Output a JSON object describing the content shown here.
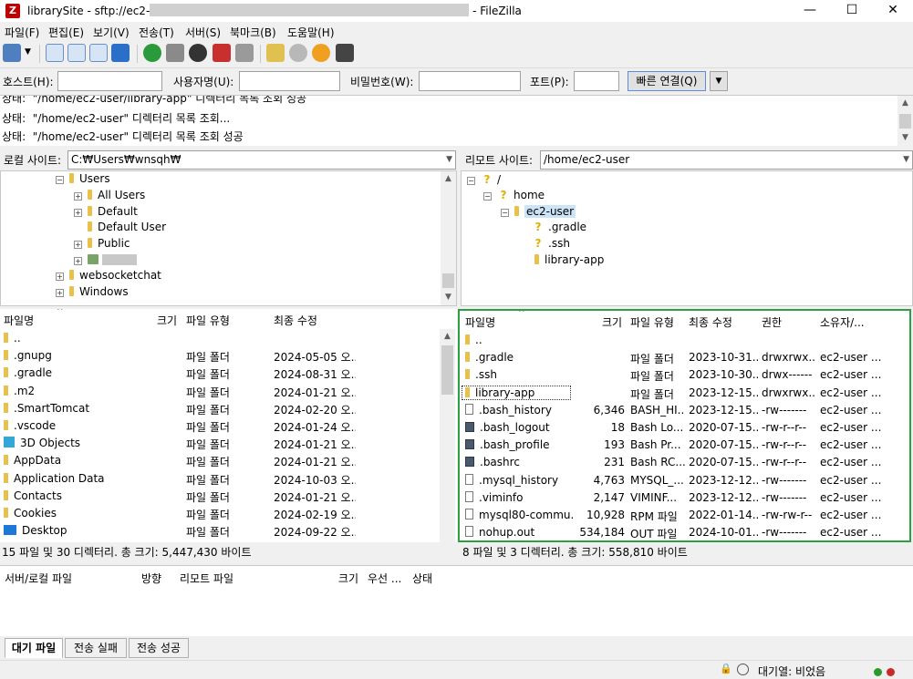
{
  "window": {
    "title_prefix": "librarySite - sftp://ec2-",
    "title_suffix": " - FileZilla"
  },
  "menu": [
    "파일(F)",
    "편집(E)",
    "보기(V)",
    "전송(T)",
    "서버(S)",
    "북마크(B)",
    "도움말(H)"
  ],
  "quickconnect": {
    "host_label": "호스트(H):",
    "user_label": "사용자명(U):",
    "pass_label": "비밀번호(W):",
    "port_label": "포트(P):",
    "connect_label": "빠른 연결(Q)"
  },
  "log": [
    "상태:  \"/home/ec2-user/library-app\" 디렉터리 목록 조회 성공",
    "상태:  \"/home/ec2-user\" 디렉터리 목록 조회...",
    "상태:  \"/home/ec2-user\" 디렉터리 목록 조회 성공"
  ],
  "local": {
    "site_label": "로컬 사이트:",
    "path": "C:₩Users₩wnsqh₩",
    "tree": [
      "Users",
      "All Users",
      "Default",
      "Default User",
      "Public",
      "websocketchat",
      "Windows"
    ],
    "headers": {
      "name": "파일명",
      "size": "크기",
      "type": "파일 유형",
      "modified": "최종 수정"
    },
    "rows": [
      {
        "name": "..",
        "type": "",
        "modified": ""
      },
      {
        "name": ".gnupg",
        "type": "파일 폴더",
        "modified": "2024-05-05 오..."
      },
      {
        "name": ".gradle",
        "type": "파일 폴더",
        "modified": "2024-08-31 오..."
      },
      {
        "name": ".m2",
        "type": "파일 폴더",
        "modified": "2024-01-21 오..."
      },
      {
        "name": ".SmartTomcat",
        "type": "파일 폴더",
        "modified": "2024-02-20 오..."
      },
      {
        "name": ".vscode",
        "type": "파일 폴더",
        "modified": "2024-01-24 오..."
      },
      {
        "name": "3D Objects",
        "type": "파일 폴더",
        "modified": "2024-01-21 오..."
      },
      {
        "name": "AppData",
        "type": "파일 폴더",
        "modified": "2024-01-21 오..."
      },
      {
        "name": "Application Data",
        "type": "파일 폴더",
        "modified": "2024-10-03 오..."
      },
      {
        "name": "Contacts",
        "type": "파일 폴더",
        "modified": "2024-01-21 오..."
      },
      {
        "name": "Cookies",
        "type": "파일 폴더",
        "modified": "2024-02-19 오..."
      },
      {
        "name": "Desktop",
        "type": "파일 폴더",
        "modified": "2024-09-22 오..."
      }
    ],
    "status": "15 파일 및 30 디렉터리. 총 크기: 5,447,430 바이트"
  },
  "remote": {
    "site_label": "리모트 사이트:",
    "path": "/home/ec2-user",
    "tree": [
      "/",
      "home",
      "ec2-user",
      ".gradle",
      ".ssh",
      "library-app"
    ],
    "headers": {
      "name": "파일명",
      "size": "크기",
      "type": "파일 유형",
      "modified": "최종 수정",
      "perm": "권한",
      "owner": "소유자/..."
    },
    "rows": [
      {
        "name": "..",
        "size": "",
        "type": "",
        "modified": "",
        "perm": "",
        "owner": ""
      },
      {
        "name": ".gradle",
        "size": "",
        "type": "파일 폴더",
        "modified": "2023-10-31...",
        "perm": "drwxrwx...",
        "owner": "ec2-user ..."
      },
      {
        "name": ".ssh",
        "size": "",
        "type": "파일 폴더",
        "modified": "2023-10-30...",
        "perm": "drwx------",
        "owner": "ec2-user ..."
      },
      {
        "name": "library-app",
        "size": "",
        "type": "파일 폴더",
        "modified": "2023-12-15...",
        "perm": "drwxrwx...",
        "owner": "ec2-user ..."
      },
      {
        "name": ".bash_history",
        "size": "6,346",
        "type": "BASH_HI...",
        "modified": "2023-12-15...",
        "perm": "-rw-------",
        "owner": "ec2-user ..."
      },
      {
        "name": ".bash_logout",
        "size": "18",
        "type": "Bash Lo...",
        "modified": "2020-07-15...",
        "perm": "-rw-r--r--",
        "owner": "ec2-user ..."
      },
      {
        "name": ".bash_profile",
        "size": "193",
        "type": "Bash Pr...",
        "modified": "2020-07-15...",
        "perm": "-rw-r--r--",
        "owner": "ec2-user ..."
      },
      {
        "name": ".bashrc",
        "size": "231",
        "type": "Bash RC...",
        "modified": "2020-07-15...",
        "perm": "-rw-r--r--",
        "owner": "ec2-user ..."
      },
      {
        "name": ".mysql_history",
        "size": "4,763",
        "type": "MYSQL_...",
        "modified": "2023-12-12...",
        "perm": "-rw-------",
        "owner": "ec2-user ..."
      },
      {
        "name": ".viminfo",
        "size": "2,147",
        "type": "VIMINF...",
        "modified": "2023-12-12...",
        "perm": "-rw-------",
        "owner": "ec2-user ..."
      },
      {
        "name": "mysql80-commu...",
        "size": "10,928",
        "type": "RPM 파일",
        "modified": "2022-01-14...",
        "perm": "-rw-rw-r--",
        "owner": "ec2-user ..."
      },
      {
        "name": "nohup.out",
        "size": "534,184",
        "type": "OUT 파일",
        "modified": "2024-10-01...",
        "perm": "-rw-------",
        "owner": "ec2-user ..."
      }
    ],
    "status": "8 파일 및 3 디렉터리. 총 크기: 558,810 바이트"
  },
  "queue": {
    "headers": [
      "서버/로컬 파일",
      "방향",
      "리모트 파일",
      "크기",
      "우선 ...",
      "상태"
    ]
  },
  "tabs": [
    "대기 파일",
    "전송 실패",
    "전송 성공"
  ],
  "bottom_status": "대기열: 비었음",
  "colors": {
    "highlight": "#2ea043",
    "folder": "#e8c04a",
    "connect_border": "#5c8dd6"
  }
}
